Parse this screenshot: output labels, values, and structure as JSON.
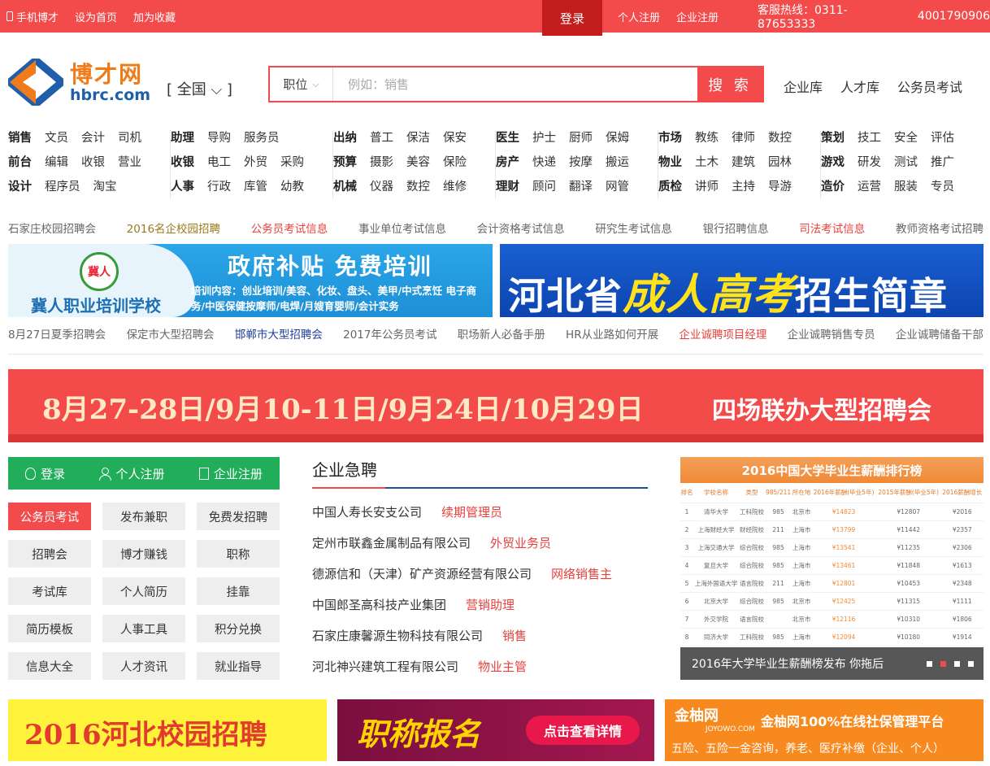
{
  "topbar": {
    "mobile": "手机博才",
    "homepage": "设为首页",
    "favorite": "加为收藏",
    "login": "登录",
    "personal_register": "个人注册",
    "company_register": "企业注册",
    "hotline_label": "客服热线：0311-87653333",
    "hotline_2": "4001790906"
  },
  "header": {
    "logo_cn": "博才网",
    "logo_en": "hbrc.com",
    "region": "[ 全国 ⌵ ]",
    "search_type": "职位",
    "search_placeholder": "例如：销售",
    "search_button": "搜 索",
    "links": [
      "企业库",
      "人才库",
      "公务员考试"
    ]
  },
  "categories": [
    [
      [
        "销售",
        "文员",
        "会计",
        "司机"
      ],
      [
        "前台",
        "编辑",
        "收银",
        "营业"
      ],
      [
        "设计",
        "程序员",
        "淘宝"
      ]
    ],
    [
      [
        "助理",
        "导购",
        "服务员"
      ],
      [
        "收银",
        "电工",
        "外贸",
        "采购"
      ],
      [
        "人事",
        "行政",
        "库管",
        "幼教"
      ]
    ],
    [
      [
        "出纳",
        "普工",
        "保洁",
        "保安"
      ],
      [
        "预算",
        "摄影",
        "美容",
        "保险"
      ],
      [
        "机械",
        "仪器",
        "数控",
        "维修"
      ]
    ],
    [
      [
        "医生",
        "护士",
        "厨师",
        "保姆"
      ],
      [
        "房产",
        "快递",
        "按摩",
        "搬运"
      ],
      [
        "理财",
        "顾问",
        "翻译",
        "网管"
      ]
    ],
    [
      [
        "市场",
        "教练",
        "律师",
        "数控"
      ],
      [
        "物业",
        "土木",
        "建筑",
        "园林"
      ],
      [
        "质检",
        "讲师",
        "主持",
        "导游"
      ]
    ],
    [
      [
        "策划",
        "技工",
        "安全",
        "评估"
      ],
      [
        "游戏",
        "研发",
        "测试",
        "推广"
      ],
      [
        "造价",
        "运营",
        "服装",
        "专员"
      ]
    ]
  ],
  "links_row1": [
    {
      "text": "石家庄校园招聘会",
      "color": "#666"
    },
    {
      "text": "2016名企校园招聘",
      "color": "#9a7a1a"
    },
    {
      "text": "公务员考试信息",
      "color": "#e8413d"
    },
    {
      "text": "事业单位考试信息",
      "color": "#666"
    },
    {
      "text": "会计资格考试信息",
      "color": "#666"
    },
    {
      "text": "研究生考试信息",
      "color": "#666"
    },
    {
      "text": "银行招聘信息",
      "color": "#666"
    },
    {
      "text": "司法考试信息",
      "color": "#e8413d"
    },
    {
      "text": "教师资格考试招聘",
      "color": "#666"
    }
  ],
  "banner_left": {
    "badge": "冀人",
    "school": "冀人职业培训学校",
    "slogan": "政府补贴 免费培训",
    "desc": "培训内容：创业培训/美容、化妆、盘头、美甲/中式烹饪 电子商务/中医保健按摩师/电焊/月嫂育婴师/会计实务"
  },
  "banner_right": {
    "part1": "河北省",
    "part2": "成人高考",
    "part3": "招生简章"
  },
  "links_row2": [
    {
      "text": "8月27日夏季招聘会",
      "color": "#666"
    },
    {
      "text": "保定市大型招聘会",
      "color": "#666"
    },
    {
      "text": "邯郸市大型招聘会",
      "color": "#1f3f9a"
    },
    {
      "text": "2017年公务员考试",
      "color": "#666"
    },
    {
      "text": "职场新人必备手册",
      "color": "#666"
    },
    {
      "text": "HR从业路如何开展",
      "color": "#666"
    },
    {
      "text": "企业诚聘项目经理",
      "color": "#e8413d"
    },
    {
      "text": "企业诚聘销售专员",
      "color": "#666"
    },
    {
      "text": "企业诚聘储备干部",
      "color": "#666"
    }
  ],
  "banner_wide": {
    "dates": "8月27-28日/9月10-11日/9月24日/10月29日",
    "title": "四场联办大型招聘会"
  },
  "auth": {
    "login": "登录",
    "personal": "个人注册",
    "company": "企业注册"
  },
  "quick_buttons": [
    {
      "label": "公务员考试",
      "active": true
    },
    {
      "label": "发布兼职",
      "active": false
    },
    {
      "label": "免费发招聘",
      "active": false
    },
    {
      "label": "招聘会",
      "active": false
    },
    {
      "label": "博才赚钱",
      "active": false
    },
    {
      "label": "职称",
      "active": false
    },
    {
      "label": "考试库",
      "active": false
    },
    {
      "label": "个人简历",
      "active": false
    },
    {
      "label": "挂靠",
      "active": false
    },
    {
      "label": "简历模板",
      "active": false
    },
    {
      "label": "人事工具",
      "active": false
    },
    {
      "label": "积分兑换",
      "active": false
    },
    {
      "label": "信息大全",
      "active": false
    },
    {
      "label": "人才资讯",
      "active": false
    },
    {
      "label": "就业指导",
      "active": false
    }
  ],
  "urgent": {
    "title": "企业急聘",
    "jobs": [
      {
        "company": "中国人寿长安支公司",
        "position": "续期管理员"
      },
      {
        "company": "定州市联鑫金属制品有限公司",
        "position": "外贸业务员"
      },
      {
        "company": "德源信和（天津）矿产资源经营有限公司",
        "position": "网络销售主"
      },
      {
        "company": "中国郎圣高科技产业集团",
        "position": "营销助理"
      },
      {
        "company": "石家庄康馨源生物科技有限公司",
        "position": "销售"
      },
      {
        "company": "河北神兴建筑工程有限公司",
        "position": "物业主管"
      }
    ]
  },
  "ranking": {
    "title": "2016中国大学毕业生薪酬排行榜",
    "headers": [
      "排名",
      "学校名称",
      "类型",
      "985/211",
      "所在地",
      "2016年薪酬(毕业5年)",
      "2015年薪酬(毕业5年)",
      "2016薪酬增长"
    ],
    "rows": [
      [
        "1",
        "清华大学",
        "工科院校",
        "985",
        "北京市",
        "¥14823",
        "¥12807",
        "¥2016"
      ],
      [
        "2",
        "上海财经大学",
        "财经院校",
        "211",
        "上海市",
        "¥13799",
        "¥11442",
        "¥2357"
      ],
      [
        "3",
        "上海交通大学",
        "综合院校",
        "985",
        "上海市",
        "¥13541",
        "¥11235",
        "¥2306"
      ],
      [
        "4",
        "复旦大学",
        "综合院校",
        "985",
        "上海市",
        "¥13461",
        "¥11848",
        "¥1613"
      ],
      [
        "5",
        "上海外国语大学",
        "语言院校",
        "211",
        "上海市",
        "¥12801",
        "¥10453",
        "¥2348"
      ],
      [
        "6",
        "北京大学",
        "综合院校",
        "985",
        "北京市",
        "¥12425",
        "¥11315",
        "¥1111"
      ],
      [
        "7",
        "外交学院",
        "语言院校",
        "",
        "北京市",
        "¥12116",
        "¥10310",
        "¥1806"
      ],
      [
        "8",
        "同济大学",
        "工科院校",
        "985",
        "上海市",
        "¥12094",
        "¥10180",
        "¥1914"
      ]
    ],
    "caption": "2016年大学毕业生薪酬榜发布 你拖后"
  },
  "bottom": {
    "b1": "2016河北校园招聘",
    "b2_title": "职称报名",
    "b2_button": "点击查看详情",
    "b3_logo": "金柚网",
    "b3_logo_en": "JOYOWO.COM",
    "b3_title": "金柚网100%在线社保管理平台",
    "b3_sub": "五险、五险一金咨询，养老、医疗补缴（企业、个人）"
  }
}
